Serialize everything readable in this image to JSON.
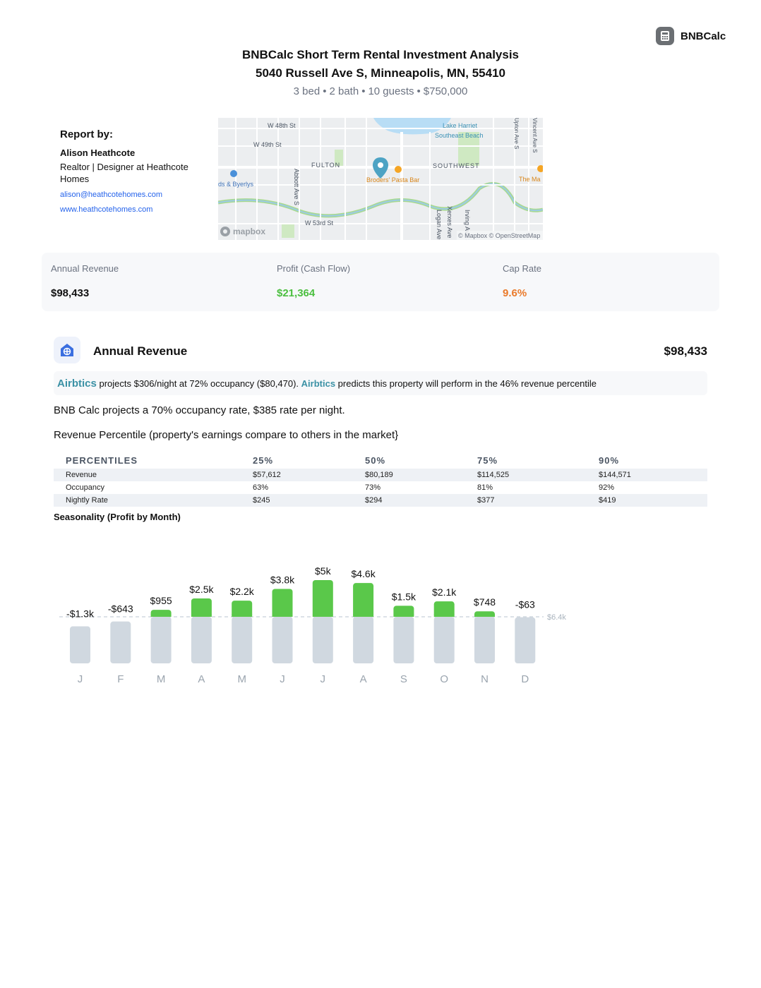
{
  "brand": {
    "name": "BNBCalc",
    "icon": "calculator-icon"
  },
  "header": {
    "title_line1": "BNBCalc Short Term Rental Investment Analysis",
    "title_line2": "5040 Russell Ave S, Minneapolis, MN, 55410",
    "beds": "3 bed",
    "baths": "2 bath",
    "guests": "10 guests",
    "price": "$750,000",
    "sep": "•"
  },
  "report": {
    "heading": "Report by:",
    "name": "Alison Heathcote",
    "role": "Realtor | Designer at Heathcote Homes",
    "email": "alison@heathcotehomes.com",
    "website": "www.heathcotehomes.com"
  },
  "map": {
    "labels": [
      "W 48th St",
      "W 49th St",
      "FULTON",
      "SOUTHWEST",
      "Lake Harriet",
      "Southeast Beach",
      "Abbott Ave S",
      "W 53rd St",
      "Logan Ave S",
      "Irving Ave S",
      "Xerxes Ave S",
      "Broders' Pasta Bar",
      "The Ma",
      "ds & Byerlys",
      "mapbox",
      "© Mapbox © OpenStreetMap",
      "Upton Ave S",
      "Vincent Ave S"
    ]
  },
  "stats": [
    {
      "label": "Annual Revenue",
      "value": "$98,433",
      "color": "#111111"
    },
    {
      "label": "Profit (Cash Flow)",
      "value": "$21,364",
      "color": "#4bbf3f"
    },
    {
      "label": "Cap Rate",
      "value": "9.6%",
      "color": "#ea7a2a"
    }
  ],
  "revenue_section": {
    "icon": "home-grid-icon",
    "title": "Annual Revenue",
    "amount": "$98,433",
    "callout": {
      "brand1": "Airbtics",
      "text1": " projects $306/night at 72% occupancy ($80,470). ",
      "brand2": "Airbtics",
      "text2": " predicts this property will perform in the 46% revenue percentile"
    },
    "projection": "BNB Calc projects a 70% occupancy rate, $385 rate per night.",
    "percentile_heading": "Revenue Percentile (property's earnings compare to others in the market}"
  },
  "percentiles": {
    "headers": [
      "PERCENTILES",
      "25%",
      "50%",
      "75%",
      "90%"
    ],
    "rows": [
      [
        "Revenue",
        "$57,612",
        "$80,189",
        "$114,525",
        "$144,571"
      ],
      [
        "Occupancy",
        "63%",
        "73%",
        "81%",
        "92%"
      ],
      [
        "Nightly Rate",
        "$245",
        "$294",
        "$377",
        "$419"
      ]
    ]
  },
  "seasonality_title": "Seasonality (Profit by Month)",
  "chart_data": {
    "type": "bar",
    "title": "Seasonality (Profit by Month)",
    "categories": [
      "J",
      "F",
      "M",
      "A",
      "M",
      "J",
      "J",
      "A",
      "S",
      "O",
      "N",
      "D"
    ],
    "values": [
      -1300,
      -643,
      955,
      2500,
      2200,
      3800,
      5000,
      4600,
      1500,
      2100,
      748,
      -63
    ],
    "labels": [
      "-$1.3k",
      "-$643",
      "$955",
      "$2.5k",
      "$2.2k",
      "$3.8k",
      "$5k",
      "$4.6k",
      "$1.5k",
      "$2.1k",
      "$748",
      "-$63"
    ],
    "reference_label": "$6.4k",
    "positive_color": "#5ac84a",
    "base_color": "#d0d8e0",
    "grid": false
  }
}
